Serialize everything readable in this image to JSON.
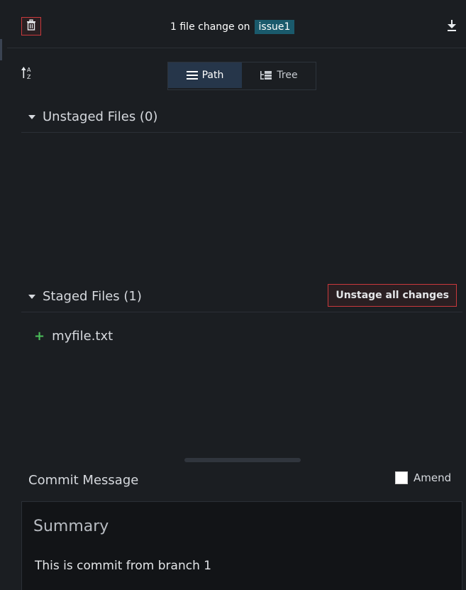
{
  "header": {
    "title_prefix": "1 file change on",
    "branch": "issue1"
  },
  "view_toggle": {
    "path_label": "Path",
    "tree_label": "Tree"
  },
  "unstaged": {
    "title": "Unstaged Files (0)"
  },
  "staged": {
    "title": "Staged Files (1)",
    "unstage_all_label": "Unstage all changes",
    "files": [
      {
        "name": "myfile.txt",
        "status": "added"
      }
    ]
  },
  "commit": {
    "label": "Commit Message",
    "amend_label": "Amend",
    "amend_checked": false,
    "summary_placeholder": "Summary",
    "description": "This is commit from branch 1"
  },
  "icons": {
    "discard": "trash-icon",
    "download": "download-icon",
    "sort": "sort-alpha-icon",
    "path": "list-icon",
    "tree": "tree-icon",
    "added": "plus-icon"
  },
  "colors": {
    "background": "#1b1e22",
    "danger": "#c9393c",
    "branch_badge": "#1a5a6c",
    "active_toggle": "#26364a",
    "added": "#4bbf5a"
  }
}
